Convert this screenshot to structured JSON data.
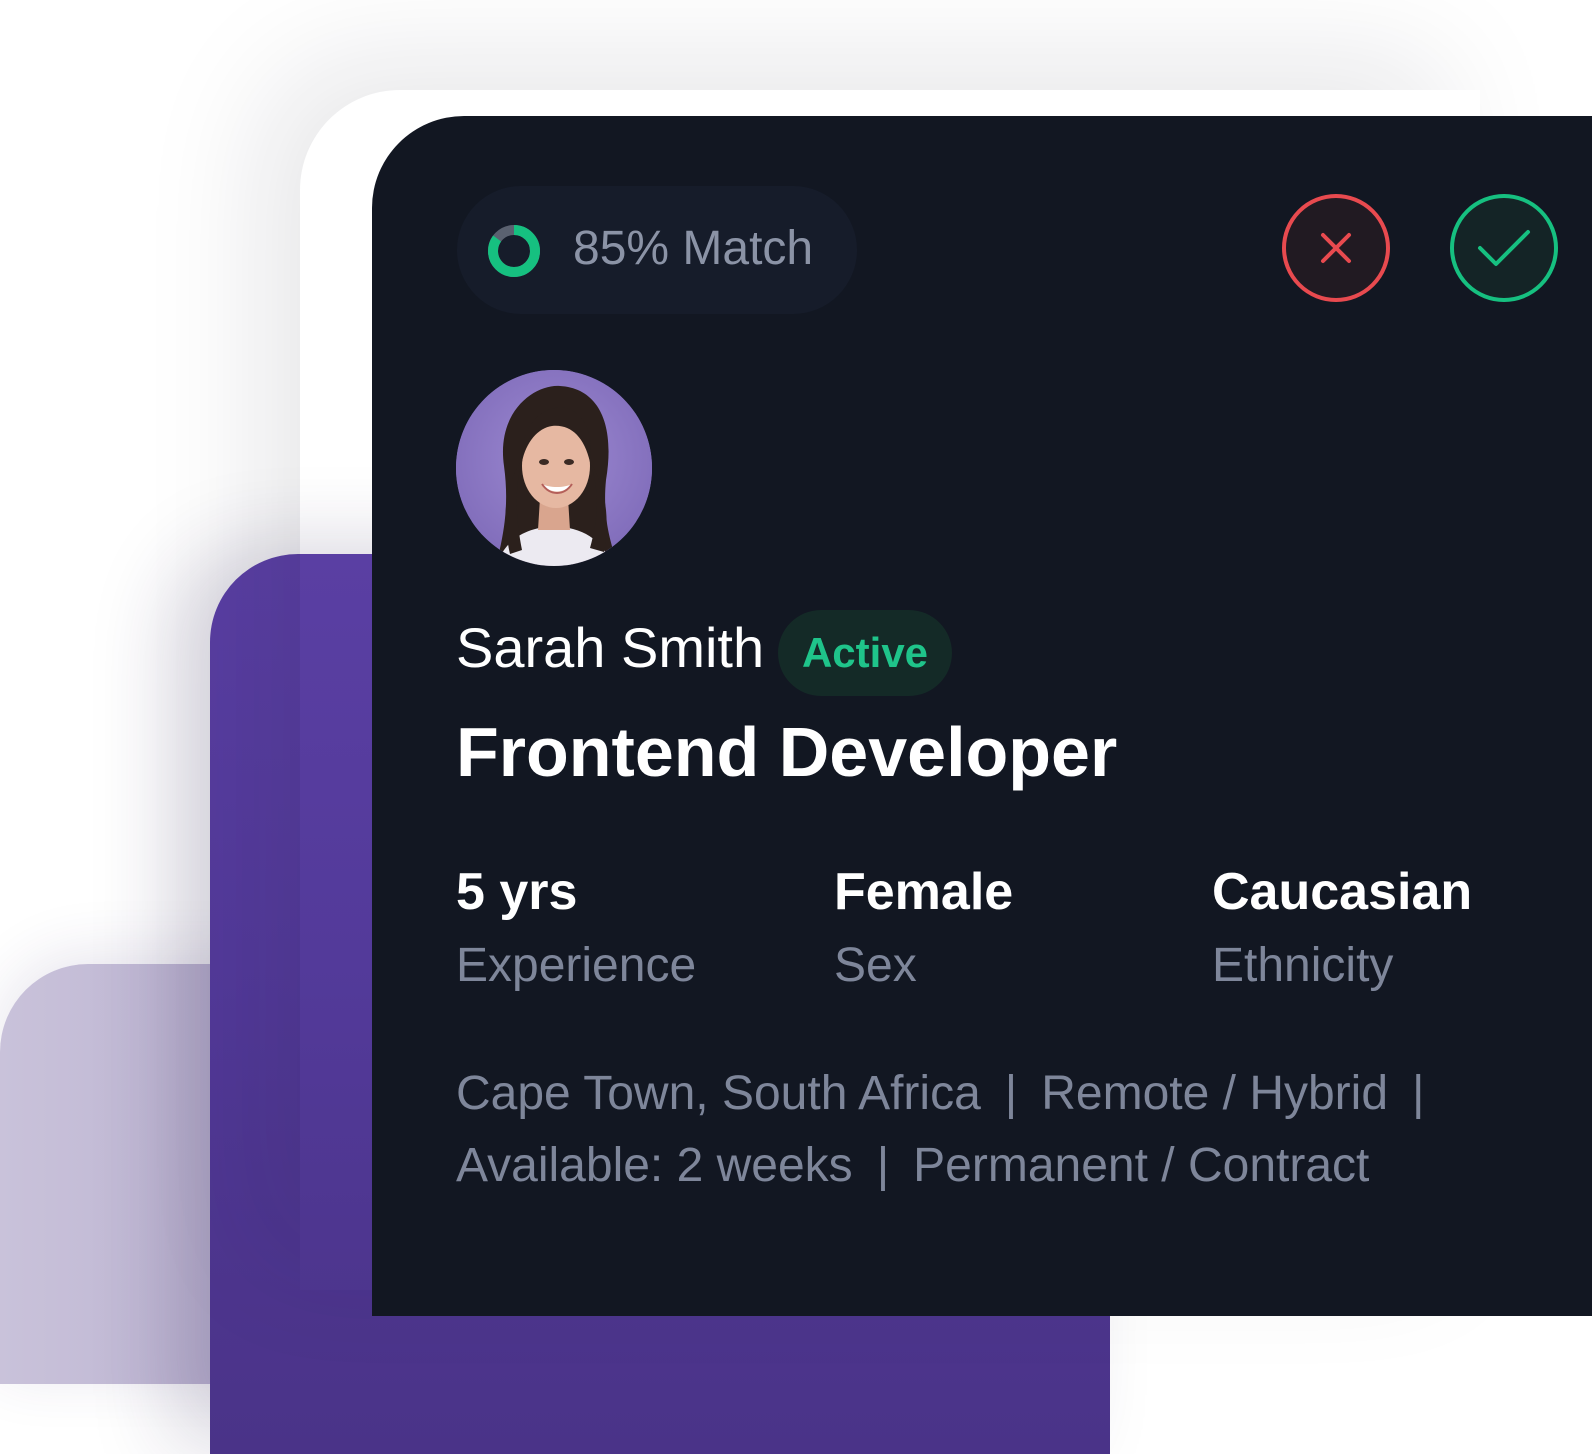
{
  "match": {
    "percent": 85,
    "label": "85% Match"
  },
  "actions": {
    "reject_icon": "close-icon",
    "accept_icon": "check-icon"
  },
  "profile": {
    "name": "Sarah Smith",
    "status": "Active",
    "title": "Frontend Developer",
    "avatar_icon": "avatar"
  },
  "stats": [
    {
      "value": "5 yrs",
      "label": "Experience"
    },
    {
      "value": "Female",
      "label": "Sex"
    },
    {
      "value": "Caucasian",
      "label": "Ethnicity"
    }
  ],
  "meta": {
    "location": "Cape Town, South Africa",
    "work_mode": "Remote / Hybrid",
    "availability": "Available: 2 weeks",
    "contract_type": "Permanent / Contract",
    "separator": "|"
  },
  "colors": {
    "card_bg": "#121722",
    "accent_green": "#16c080",
    "reject_red": "#e84a4f",
    "purple": "#533a9a",
    "muted_text": "#7e869a"
  }
}
